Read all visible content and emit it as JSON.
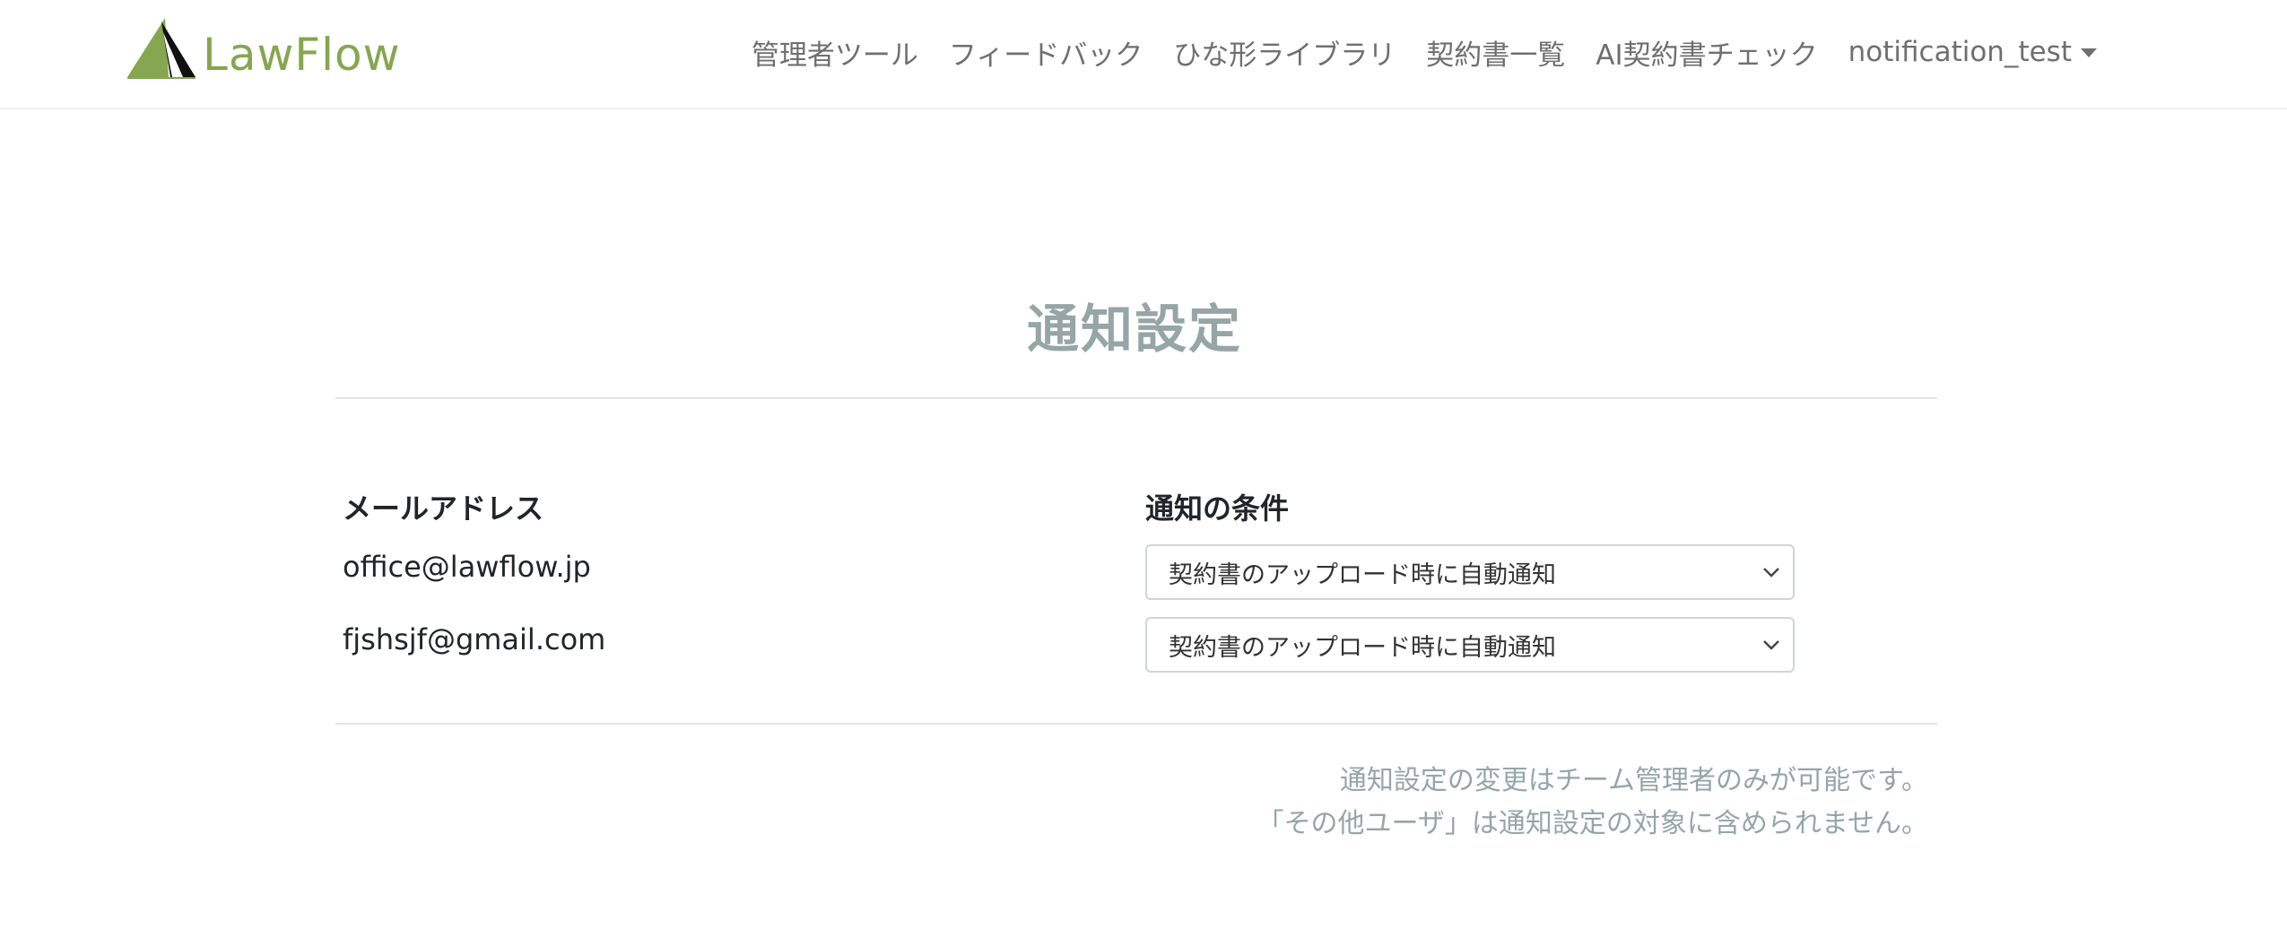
{
  "brand": {
    "name": "LawFlow",
    "logo_icon": "sail-triangle-icon",
    "color": "#86a64f"
  },
  "nav": {
    "items": [
      {
        "label": "管理者ツール"
      },
      {
        "label": "フィードバック"
      },
      {
        "label": "ひな形ライブラリ"
      },
      {
        "label": "契約書一覧"
      },
      {
        "label": "AI契約書チェック"
      }
    ],
    "user_menu": {
      "label": "notification_test",
      "icon": "caret-down-icon"
    }
  },
  "main": {
    "title": "通知設定",
    "columns": {
      "email": "メールアドレス",
      "condition": "通知の条件"
    },
    "rows": [
      {
        "email": "office@lawflow.jp",
        "condition": "契約書のアップロード時に自動通知"
      },
      {
        "email": "fjshsjf@gmail.com",
        "condition": "契約書のアップロード時に自動通知"
      }
    ],
    "notes": [
      "通知設定の変更はチーム管理者のみが可能です。",
      "「その他ユーザ」は通知設定の対象に含められません。"
    ]
  },
  "colors": {
    "title": "#96a5a6",
    "nav_text": "#6f6f6f",
    "divider": "#e4e4e4"
  }
}
